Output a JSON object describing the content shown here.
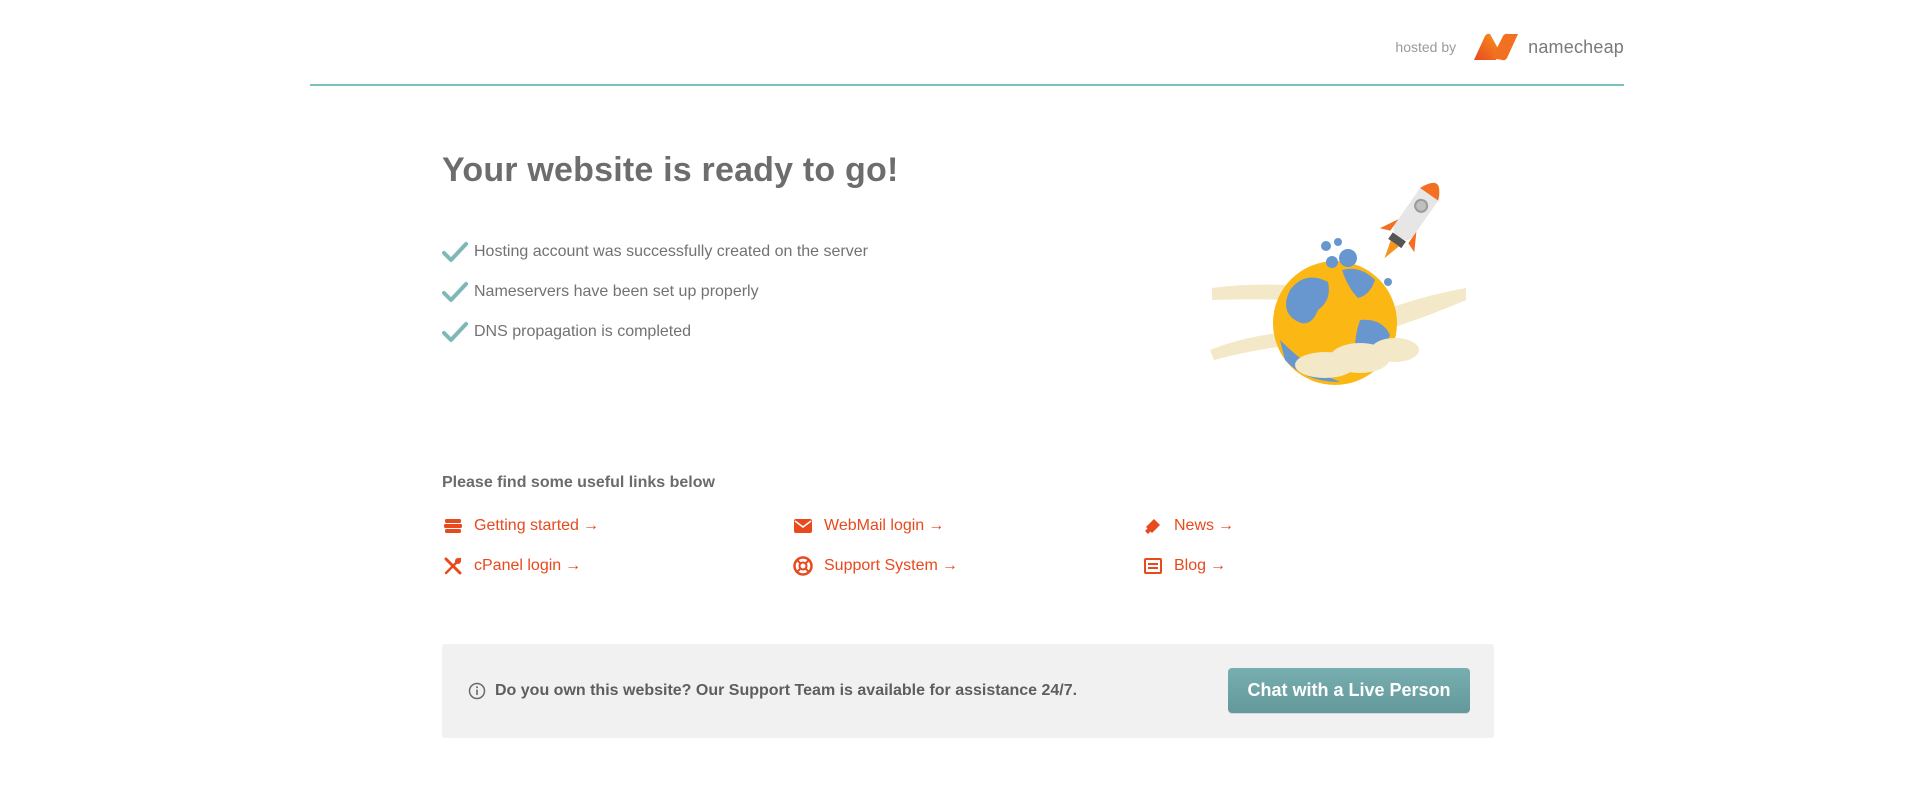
{
  "header": {
    "hosted_by_label": "hosted by",
    "brand_name": "namecheap"
  },
  "main": {
    "title": "Your website is ready to go!",
    "checks": [
      "Hosting account was successfully created on the server",
      "Nameservers have been set up properly",
      "DNS propagation is completed"
    ]
  },
  "links": {
    "title": "Please find some useful links below",
    "items": [
      {
        "label": "Getting started",
        "icon": "getting-started-icon"
      },
      {
        "label": "WebMail login",
        "icon": "mail-icon"
      },
      {
        "label": "News",
        "icon": "megaphone-icon"
      },
      {
        "label": "cPanel login",
        "icon": "tools-icon"
      },
      {
        "label": "Support System",
        "icon": "lifebuoy-icon"
      },
      {
        "label": "Blog",
        "icon": "blog-icon"
      }
    ],
    "arrow": "→"
  },
  "support": {
    "text": "Do you own this website? Our Support Team is available for assistance 24/7.",
    "chat_button": "Chat with a Live Person"
  },
  "colors": {
    "accent_teal": "#79c2bd",
    "link_orange": "#e8491d",
    "button_teal": "#6ba3a5"
  }
}
